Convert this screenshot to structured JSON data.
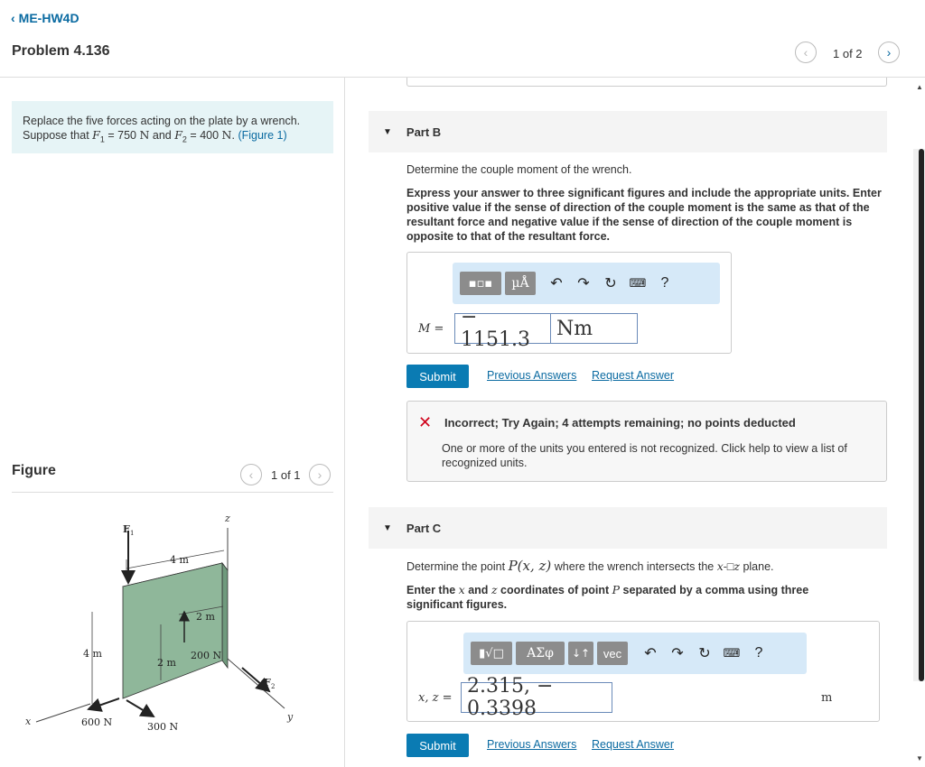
{
  "header": {
    "back_label": "ME-HW4D",
    "problem_title": "Problem 4.136",
    "pager": "1 of 2"
  },
  "prompt": {
    "line1": "Replace the five forces acting on the plate by a wrench.",
    "line2_prefix": "Suppose that",
    "f1_symbol": "F",
    "f1_sub": "1",
    "f1_value": "= 750",
    "f1_unit": "N",
    "and": "and",
    "f2_symbol": "F",
    "f2_sub": "2",
    "f2_value": "= 400",
    "f2_unit": "N",
    "period": ".",
    "figure_link": "(Figure 1)"
  },
  "figure_panel": {
    "title": "Figure",
    "pager": "1 of 1",
    "labels": {
      "z": "z",
      "y": "y",
      "x": "x",
      "f1": "F",
      "f1_sub": "1",
      "f2": "F",
      "f2_sub": "2",
      "dim_4m_top": "4 m",
      "dim_2m_top": "2 m",
      "dim_2m_side": "2 m",
      "dim_4m_left": "4 m",
      "force_200": "200 N",
      "force_600": "600 N",
      "force_300": "300 N"
    },
    "colors": {
      "plate_front": "#8fb79a",
      "plate_top": "#c7dccb",
      "plate_side": "#6f9a7d"
    }
  },
  "part_b": {
    "title": "Part B",
    "question": "Determine the couple moment of the wrench.",
    "instructions": "Express your answer to three significant figures and include the appropriate units. Enter positive value if the sense of direction of the couple moment is the same as that of the resultant force and negative value if the sense of direction of the couple moment is opposite to that of the resultant force.",
    "toolbar": {
      "units_btn": "µÅ",
      "help": "?"
    },
    "answer_label": "M =",
    "answer_value": "− 1151.3",
    "answer_unit": "Nm",
    "submit": "Submit",
    "prev_answers": "Previous Answers",
    "request_answer": "Request Answer"
  },
  "feedback": {
    "title": "Incorrect; Try Again; 4 attempts remaining; no points deducted",
    "message": "One or more of the units you entered is not recognized. Click help to view a list of recognized units."
  },
  "part_c": {
    "title": "Part C",
    "question_prefix": "Determine the point",
    "question_point": "P(x, z)",
    "question_suffix": "where the wrench intersects the",
    "question_plane": "x-",
    "question_plane_box": "□",
    "question_plane_z": "z",
    "question_end": "plane.",
    "instr_prefix": "Enter the",
    "instr_x": "x",
    "instr_and": "and",
    "instr_z": "z",
    "instr_mid": "coordinates of point",
    "instr_P": "P",
    "instr_end": "separated by a comma using three significant figures.",
    "toolbar": {
      "sym_btn": "ΑΣφ",
      "swap_btn": "↓↑",
      "vec_btn": "vec",
      "help": "?"
    },
    "answer_label": "x, z =",
    "answer_value": "2.315, − 0.3398",
    "unit": "m",
    "submit": "Submit",
    "prev_answers": "Previous Answers",
    "request_answer": "Request Answer"
  }
}
